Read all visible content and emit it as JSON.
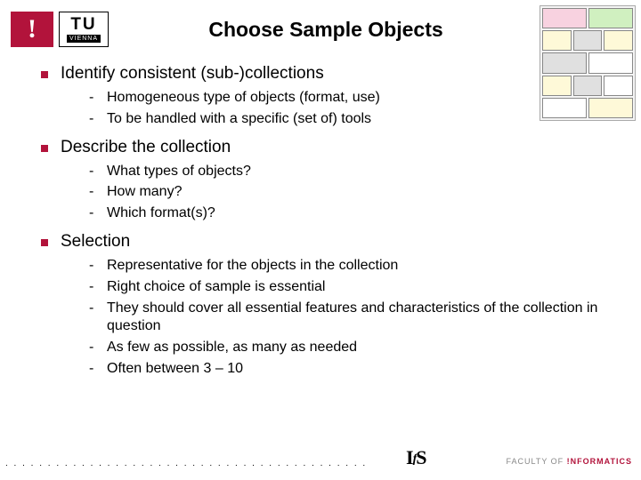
{
  "header": {
    "logo_excl": "!",
    "logo_tu_top": "TU",
    "logo_tu_bot": "VIENNA",
    "title": "Choose Sample Objects"
  },
  "sections": [
    {
      "heading": "Identify consistent (sub-)collections",
      "items": [
        "Homogeneous type of objects (format, use)",
        "To be handled with a specific (set of) tools"
      ]
    },
    {
      "heading": "Describe the collection",
      "items": [
        "What types of objects?",
        "How many?",
        "Which format(s)?"
      ]
    },
    {
      "heading": "Selection",
      "items": [
        "Representative for the objects in the collection",
        "Right choice of sample is essential",
        "They should cover all essential features and characteristics of the collection in question",
        "As few as possible, as many as needed",
        "Often between 3 – 10"
      ]
    }
  ],
  "footer": {
    "dots": ". . . . . . . . . . . . . . . . . . . . . . . . . . . . . . . . . . . . . . . . . . .",
    "ifs_i": "I",
    "ifs_f": "f",
    "ifs_s": "S",
    "faculty_pre": "FACULTY OF ",
    "faculty_bang": "!",
    "faculty_inf": "NFORMATICS"
  }
}
